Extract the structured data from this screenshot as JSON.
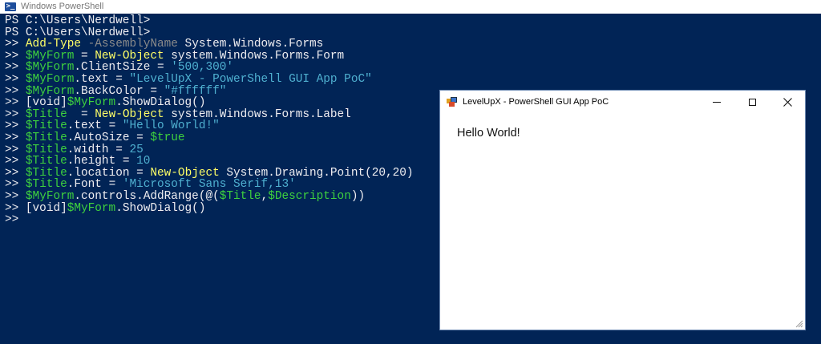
{
  "ps_window": {
    "title": "Windows PowerShell",
    "icon": "powershell-icon"
  },
  "console": {
    "lines": [
      [
        {
          "t": "PS C:\\Users\\Nerdwell>",
          "c": "white"
        }
      ],
      [
        {
          "t": "PS C:\\Users\\Nerdwell>",
          "c": "white"
        }
      ],
      [
        {
          "t": ">> ",
          "c": "white"
        },
        {
          "t": "Add-Type",
          "c": "yellow"
        },
        {
          "t": " -AssemblyName",
          "c": "gray"
        },
        {
          "t": " System.Windows.Forms",
          "c": "white"
        }
      ],
      [
        {
          "t": ">> ",
          "c": "white"
        },
        {
          "t": "$MyForm",
          "c": "green"
        },
        {
          "t": " = ",
          "c": "white"
        },
        {
          "t": "New-Object",
          "c": "yellow"
        },
        {
          "t": " system.Windows.Forms.Form",
          "c": "white"
        }
      ],
      [
        {
          "t": ">> ",
          "c": "white"
        },
        {
          "t": "$MyForm",
          "c": "green"
        },
        {
          "t": ".ClientSize = ",
          "c": "white"
        },
        {
          "t": "'500,300'",
          "c": "string"
        }
      ],
      [
        {
          "t": ">> ",
          "c": "white"
        },
        {
          "t": "$MyForm",
          "c": "green"
        },
        {
          "t": ".text = ",
          "c": "white"
        },
        {
          "t": "\"LevelUpX - PowerShell GUI App PoC\"",
          "c": "string"
        }
      ],
      [
        {
          "t": ">> ",
          "c": "white"
        },
        {
          "t": "$MyForm",
          "c": "green"
        },
        {
          "t": ".BackColor = ",
          "c": "white"
        },
        {
          "t": "\"#ffffff\"",
          "c": "string"
        }
      ],
      [
        {
          "t": ">> [void]",
          "c": "white"
        },
        {
          "t": "$MyForm",
          "c": "green"
        },
        {
          "t": ".ShowDialog()",
          "c": "white"
        }
      ],
      [
        {
          "t": ">> ",
          "c": "white"
        },
        {
          "t": "$Title",
          "c": "green"
        },
        {
          "t": "  = ",
          "c": "white"
        },
        {
          "t": "New-Object",
          "c": "yellow"
        },
        {
          "t": " system.Windows.Forms.Label",
          "c": "white"
        }
      ],
      [
        {
          "t": ">> ",
          "c": "white"
        },
        {
          "t": "$Title",
          "c": "green"
        },
        {
          "t": ".text = ",
          "c": "white"
        },
        {
          "t": "\"Hello World!\"",
          "c": "string"
        }
      ],
      [
        {
          "t": ">> ",
          "c": "white"
        },
        {
          "t": "$Title",
          "c": "green"
        },
        {
          "t": ".AutoSize = ",
          "c": "white"
        },
        {
          "t": "$true",
          "c": "green"
        }
      ],
      [
        {
          "t": ">> ",
          "c": "white"
        },
        {
          "t": "$Title",
          "c": "green"
        },
        {
          "t": ".width = ",
          "c": "white"
        },
        {
          "t": "25",
          "c": "num"
        }
      ],
      [
        {
          "t": ">> ",
          "c": "white"
        },
        {
          "t": "$Title",
          "c": "green"
        },
        {
          "t": ".height = ",
          "c": "white"
        },
        {
          "t": "10",
          "c": "num"
        }
      ],
      [
        {
          "t": ">> ",
          "c": "white"
        },
        {
          "t": "$Title",
          "c": "green"
        },
        {
          "t": ".location = ",
          "c": "white"
        },
        {
          "t": "New-Object",
          "c": "yellow"
        },
        {
          "t": " System.Drawing.Point(20,20)",
          "c": "white"
        }
      ],
      [
        {
          "t": ">> ",
          "c": "white"
        },
        {
          "t": "$Title",
          "c": "green"
        },
        {
          "t": ".Font = ",
          "c": "white"
        },
        {
          "t": "'Microsoft Sans Serif,13'",
          "c": "string"
        }
      ],
      [
        {
          "t": ">> ",
          "c": "white"
        },
        {
          "t": "$MyForm",
          "c": "green"
        },
        {
          "t": ".controls.AddRange(@(",
          "c": "white"
        },
        {
          "t": "$Title",
          "c": "green"
        },
        {
          "t": ",",
          "c": "white"
        },
        {
          "t": "$Description",
          "c": "green"
        },
        {
          "t": "))",
          "c": "white"
        }
      ],
      [
        {
          "t": ">> [void]",
          "c": "white"
        },
        {
          "t": "$MyForm",
          "c": "green"
        },
        {
          "t": ".ShowDialog()",
          "c": "white"
        }
      ],
      [
        {
          "t": ">>",
          "c": "white"
        }
      ]
    ]
  },
  "form_window": {
    "title": "LevelUpX - PowerShell GUI App PoC",
    "label_text": "Hello World!",
    "controls": {
      "minimize": "minimize-icon",
      "maximize": "maximize-icon",
      "close": "close-icon"
    }
  },
  "colors": {
    "console_bg": "#012456",
    "console_fg": "#eeedf0",
    "cmdlet": "#ffff66",
    "variable": "#3ed13e",
    "parameter": "#8a8a8a",
    "string": "#4fb0d0"
  }
}
